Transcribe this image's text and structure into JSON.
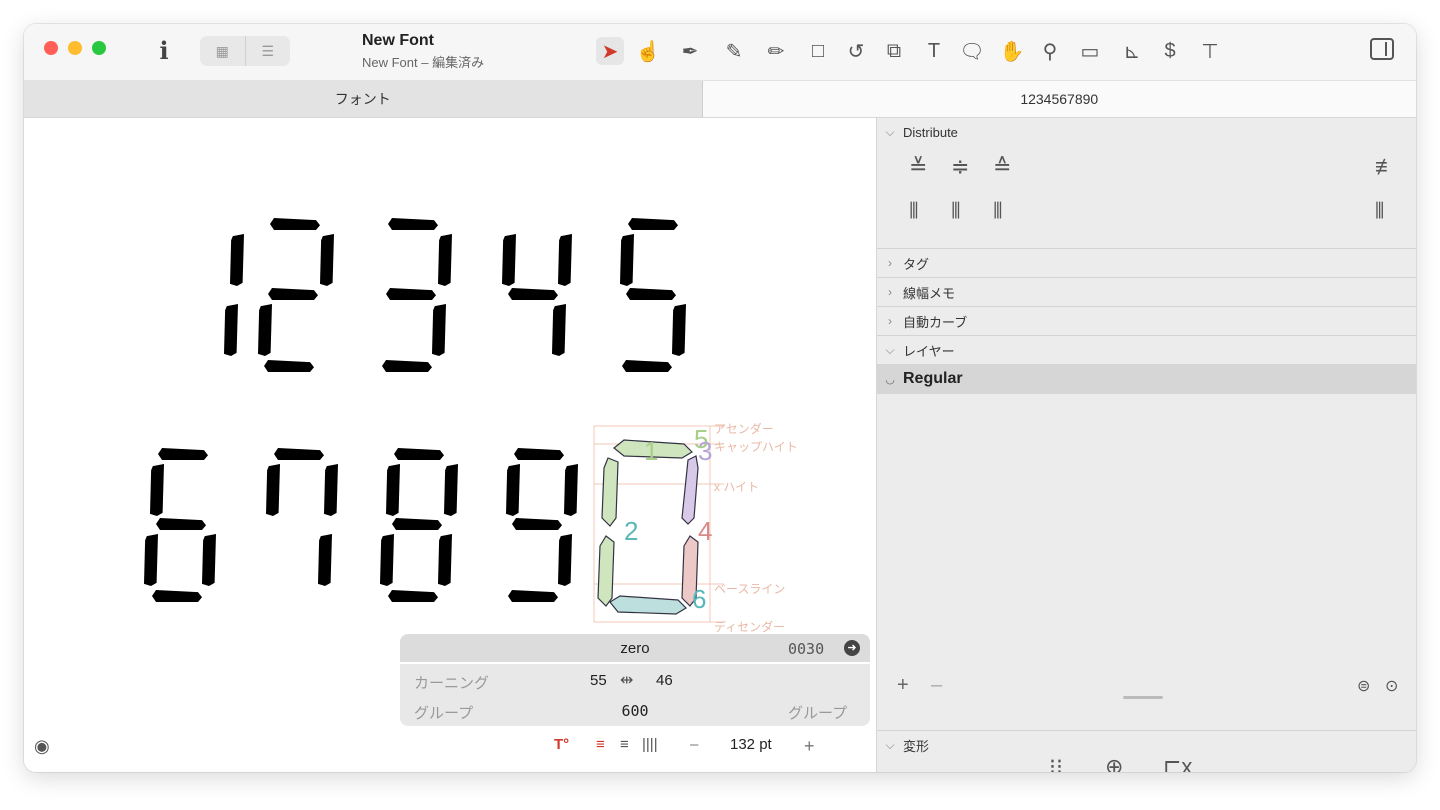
{
  "window": {
    "title": "New Font",
    "subtitle": "New Font – 編集済み"
  },
  "toolbar": {
    "tools": [
      "select-icon",
      "hand-select-icon",
      "pen-icon",
      "brush-icon",
      "pencil-icon",
      "rectangle-icon",
      "rotate-icon",
      "scale-icon",
      "text-icon",
      "annotation-icon",
      "hand-icon",
      "zoom-icon",
      "measure-icon",
      "component-icon",
      "dollar-icon",
      "metrics-icon"
    ]
  },
  "tabs": {
    "left": "フォント",
    "right": "1234567890"
  },
  "canvas": {
    "guides": {
      "ascender": "アセンダー",
      "cap_height": "キャップハイト",
      "x_height": "x ハイト",
      "baseline": "ベースライン",
      "descender": "ディセンダー"
    },
    "segment_numbers": [
      "1",
      "2",
      "4",
      "5",
      "3",
      "6"
    ]
  },
  "glyph_info": {
    "name": "zero",
    "unicode": "0030",
    "kerning_label": "カーニング",
    "kerning_left": "55",
    "kerning_right": "46",
    "group_label_left": "グループ",
    "width": "600",
    "group_label_right": "グループ"
  },
  "panel": {
    "distribute_label": "Distribute",
    "sections": [
      "タグ",
      "線幅メモ",
      "自動カーブ",
      "レイヤー"
    ],
    "layer_name": "Regular",
    "add_label": "+",
    "remove_label": "–",
    "transform_label": "変形"
  },
  "bottom_bar": {
    "point_size": "132 pt",
    "minus": "–",
    "plus": "+"
  },
  "colors": {
    "accent_red": "#d0392b",
    "segment_green": "#a8cf8a",
    "segment_purple": "#b7a3d6",
    "segment_red": "#d9898a",
    "segment_teal": "#5bb8b8"
  }
}
